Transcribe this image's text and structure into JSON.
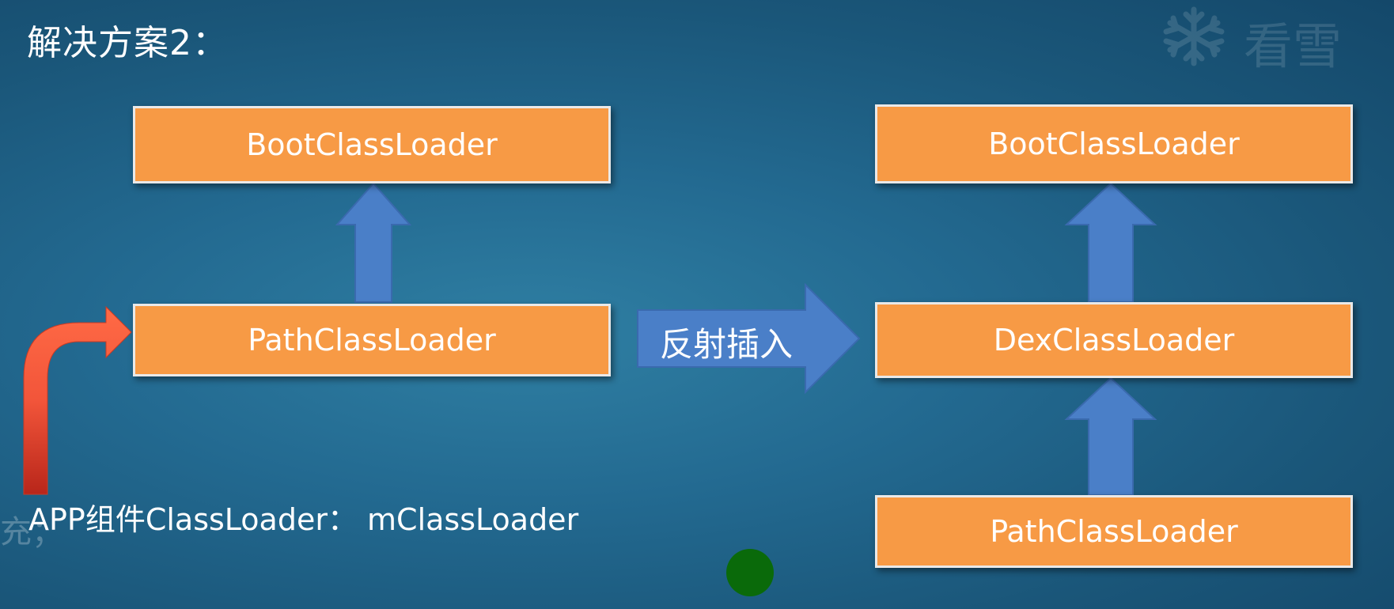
{
  "title": "解决方案2：",
  "watermark": {
    "text": "看雪"
  },
  "left_stack": {
    "top": "BootClassLoader",
    "bottom": "PathClassLoader"
  },
  "right_stack": {
    "top": "BootClassLoader",
    "middle": "DexClassLoader",
    "bottom": "PathClassLoader"
  },
  "insert_arrow_label": "反射插入",
  "app_label": "APP组件ClassLoader： mClassLoader",
  "edge_fragment": "充；",
  "colors": {
    "box_fill": "#f79a45",
    "box_border": "#e9e9e9",
    "arrow_blue": "#4a7fc8",
    "arrow_red": "#f2553a",
    "marker_green": "#0a6a0a"
  }
}
